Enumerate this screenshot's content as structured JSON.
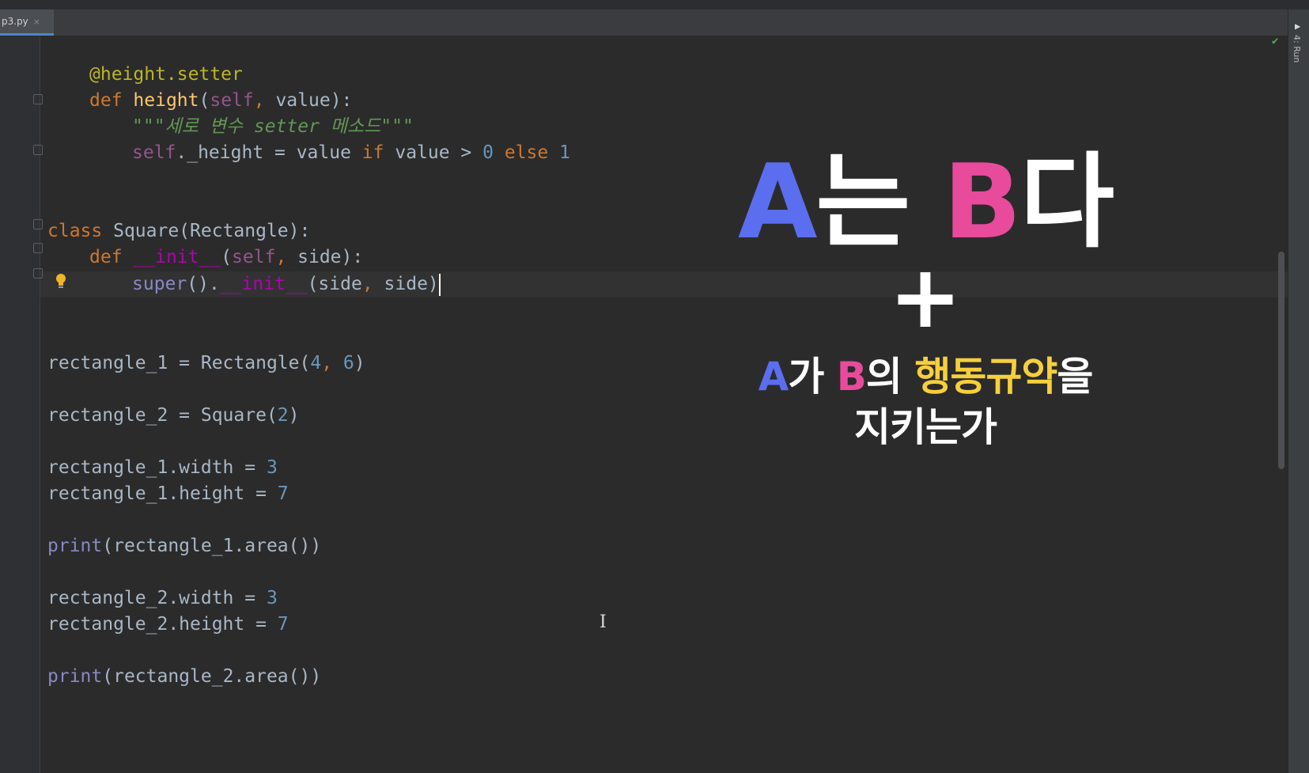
{
  "tab": {
    "filename": "p3.py",
    "close_glyph": "×"
  },
  "toolwindow": {
    "run_label": "4: Run",
    "run_icon": "play-icon"
  },
  "code": {
    "l1": {
      "decorator": "@height.setter"
    },
    "l2": {
      "def": "def",
      "name": "height",
      "open": "(",
      "self": "self",
      "comma": ",",
      "rest": " value):"
    },
    "l3": {
      "doc": "\"\"\"세로 변수 setter 메소드\"\"\""
    },
    "l4": {
      "self": "self",
      "mid": "._height = value ",
      "if": "if",
      "cond": " value > ",
      "zero": "0",
      "sp": " ",
      "else": "else",
      "sp2": " ",
      "one": "1"
    },
    "l5": {
      "class": "class",
      "rest": " Square(Rectangle):"
    },
    "l6": {
      "def": "def",
      "sp": " ",
      "init": "__init__",
      "open": "(",
      "self": "self",
      "comma": ",",
      "rest": " side):"
    },
    "l7": {
      "super": "super",
      "mid": "().",
      "init": "__init__",
      "open": "(side",
      "comma": ",",
      "rest": " side)"
    },
    "l8": {
      "a": "rectangle_1 = Rectangle(",
      "n1": "4",
      "comma": ",",
      "sp": " ",
      "n2": "6",
      "b": ")"
    },
    "l9": {
      "a": "rectangle_2 = Square(",
      "n": "2",
      "b": ")"
    },
    "l10": {
      "a": "rectangle_1.width = ",
      "n": "3"
    },
    "l11": {
      "a": "rectangle_1.height = ",
      "n": "7"
    },
    "l12": {
      "print": "print",
      "rest": "(rectangle_1.area())"
    },
    "l13": {
      "a": "rectangle_2.width = ",
      "n": "3"
    },
    "l14": {
      "a": "rectangle_2.height = ",
      "n": "7"
    },
    "l15": {
      "print": "print",
      "rest": "(rectangle_2.area())"
    }
  },
  "overlay": {
    "a": "A",
    "neun": "는",
    "space": " ",
    "b": "B",
    "da": "다",
    "plus": "+",
    "line2": {
      "a": "A",
      "ga": "가",
      "sp": " ",
      "b": "B",
      "ui": "의",
      "sp2": " ",
      "rule": "행동규약",
      "eul": "을"
    },
    "line3": "지키는가"
  },
  "colors": {
    "blue": "#5b6ef0",
    "pink": "#e84a9c",
    "yellow": "#f6cf3c",
    "keyword": "#cc7832",
    "string": "#629755",
    "number": "#6897bb"
  }
}
